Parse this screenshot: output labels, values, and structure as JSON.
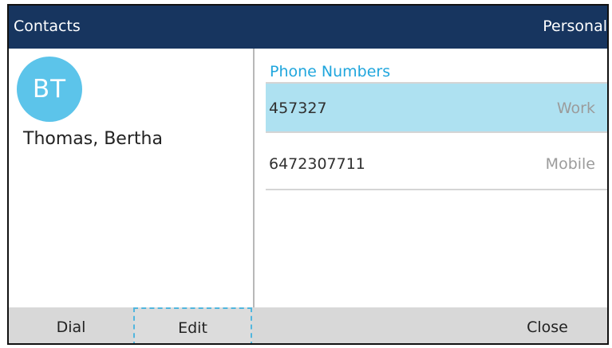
{
  "header": {
    "title": "Contacts",
    "category": "Personal"
  },
  "contact": {
    "initials": "BT",
    "name": "Thomas, Bertha"
  },
  "phone_numbers": {
    "section_title": "Phone Numbers",
    "items": [
      {
        "number": "457327",
        "type": "Work",
        "selected": true
      },
      {
        "number": "6472307711",
        "type": "Mobile",
        "selected": false
      }
    ]
  },
  "softkeys": {
    "dial": "Dial",
    "edit": "Edit",
    "close": "Close"
  },
  "colors": {
    "titlebar": "#17355f",
    "avatar": "#5cc4ea",
    "section_header": "#20a6dd",
    "selected_row": "#aee1f1",
    "softkey_bar": "#d8d8d8",
    "focus_outline": "#51b6de"
  }
}
